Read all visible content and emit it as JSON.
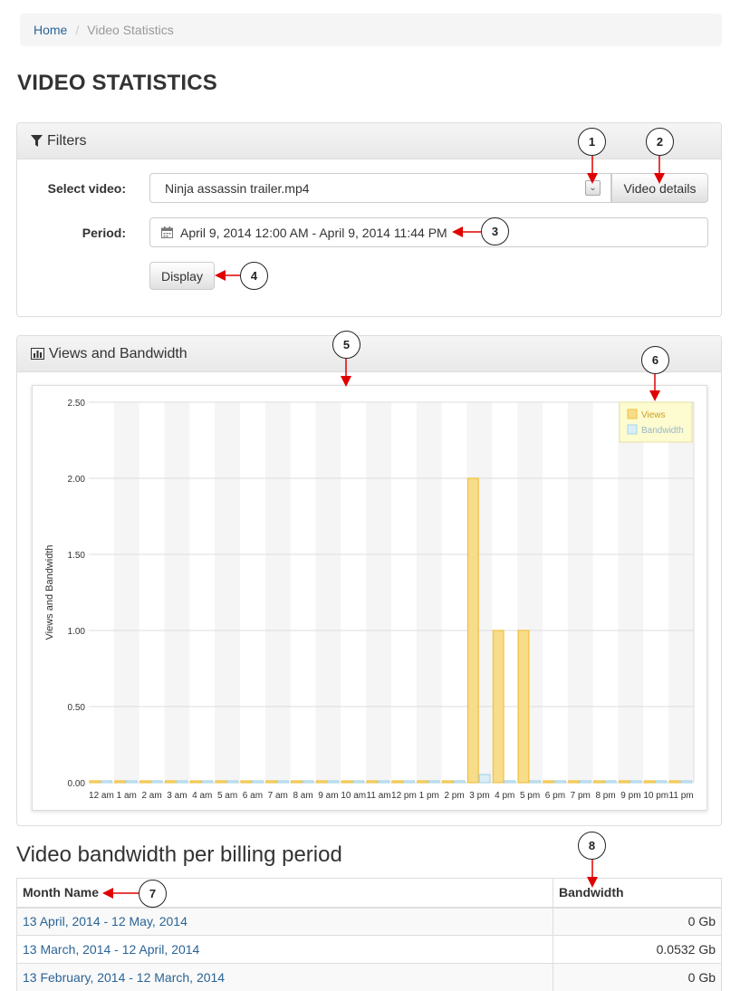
{
  "breadcrumb": {
    "home": "Home",
    "current": "Video Statistics"
  },
  "page_title": "VIDEO STATISTICS",
  "filters": {
    "heading": "Filters",
    "select_label": "Select video:",
    "selected_video": "Ninja assassin trailer.mp4",
    "details_button": "Video details",
    "period_label": "Period:",
    "period_value": "April 9, 2014 12:00 AM - April 9, 2014 11:44 PM",
    "display_button": "Display"
  },
  "chart_panel": {
    "heading": "Views and Bandwidth"
  },
  "chart_data": {
    "type": "bar",
    "ylabel": "Views and Bandwidth",
    "ylim": [
      0,
      2.5
    ],
    "yticks": [
      "0.00",
      "0.50",
      "1.00",
      "1.50",
      "2.00",
      "2.50"
    ],
    "categories": [
      "12 am",
      "1 am",
      "2 am",
      "3 am",
      "4 am",
      "5 am",
      "6 am",
      "7 am",
      "8 am",
      "9 am",
      "10 am",
      "11 am",
      "12 pm",
      "1 pm",
      "2 pm",
      "3 pm",
      "4 pm",
      "5 pm",
      "6 pm",
      "7 pm",
      "8 pm",
      "9 pm",
      "10 pm",
      "11 pm"
    ],
    "series": [
      {
        "name": "Views",
        "color": "#f0c040",
        "values": [
          0,
          0,
          0,
          0,
          0,
          0,
          0,
          0,
          0,
          0,
          0,
          0,
          0,
          0,
          0,
          2,
          1,
          1,
          0,
          0,
          0,
          0,
          0,
          0
        ]
      },
      {
        "name": "Bandwidth",
        "color": "#a8d4e8",
        "values": [
          0,
          0,
          0,
          0,
          0,
          0,
          0,
          0,
          0,
          0,
          0,
          0,
          0,
          0,
          0,
          0.0532,
          0,
          0,
          0,
          0,
          0,
          0,
          0,
          0
        ]
      }
    ],
    "grid": true,
    "legend": "top-right"
  },
  "bandwidth_section": {
    "title": "Video bandwidth per billing period",
    "columns": [
      "Month Name",
      "Bandwidth"
    ],
    "rows": [
      {
        "month": "13 April, 2014 - 12 May, 2014",
        "bandwidth": "0 Gb"
      },
      {
        "month": "13 March, 2014 - 12 April, 2014",
        "bandwidth": "0.0532 Gb"
      },
      {
        "month": "13 February, 2014 - 12 March, 2014",
        "bandwidth": "0 Gb"
      }
    ]
  },
  "callouts": [
    "1",
    "2",
    "3",
    "4",
    "5",
    "6",
    "7",
    "8"
  ],
  "colors": {
    "link": "#2a6496",
    "annotation_arrow": "#e00000"
  }
}
